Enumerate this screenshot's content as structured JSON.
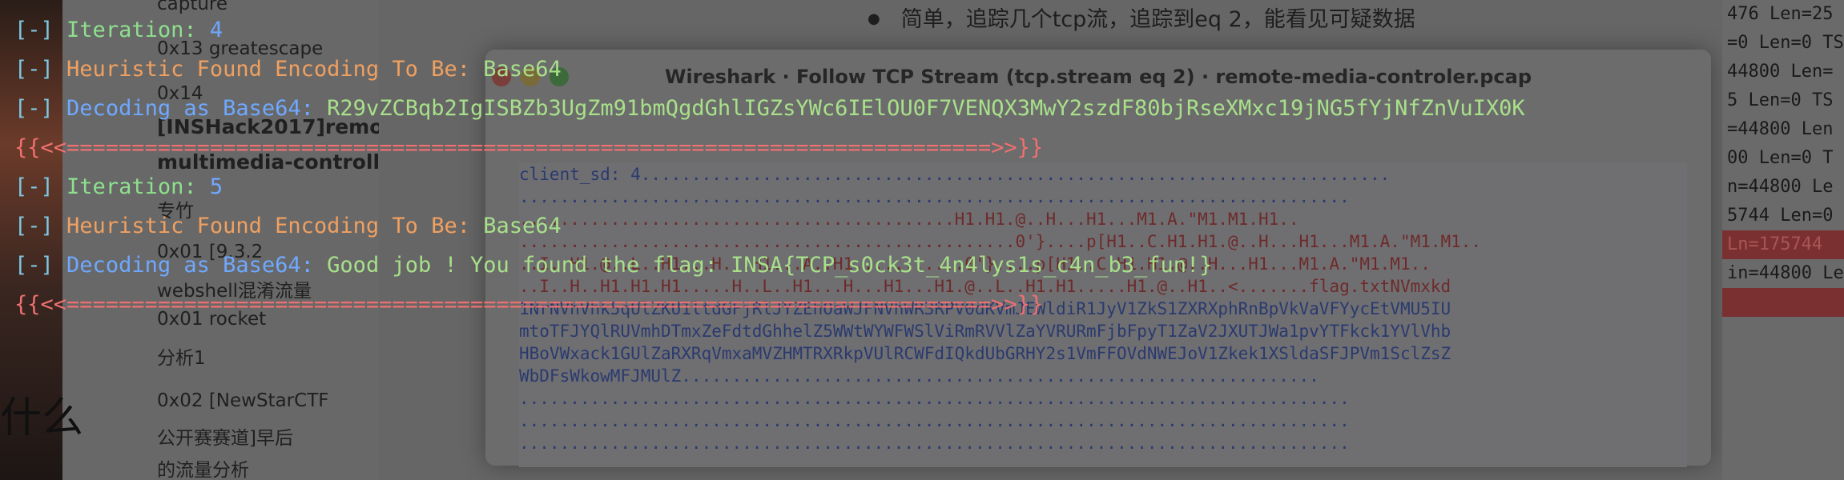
{
  "underlay": {
    "blog_sidebar": {
      "items": [
        "capture",
        "0x13 greatescape",
        "0x14",
        "[INSHack2017]remo",
        "multimedia-controller",
        "专竹",
        "0x01 [9.3.2",
        "webshell混淆流量",
        "0x01 rocket",
        "分析1",
        "0x02 [NewStarCTF",
        "公开赛赛道]早后",
        "的流量分析"
      ],
      "big_char": "什么"
    },
    "article_bullet": "简单，追踪几个tcp流，追踪到eq 2，能看见可疑数据",
    "wireshark": {
      "title": "Wireshark · Follow TCP Stream (tcp.stream eq 2) · remote-media-controler.pcap",
      "stream_lines": [
        {
          "text": "client_sd: 4..........................................................................",
          "tone": "blue"
        },
        {
          "text": "..................................................................................",
          "tone": "blue"
        },
        {
          "text": "...........................................H1.H1.@..H...H1...M1.A.\"M1.M1.H1..",
          "tone": "red"
        },
        {
          "text": ".................................................0'}....p[H1..C.H1.H1.@..H...H1...M1.A.\"M1.M1..",
          "tone": "red"
        },
        {
          "text": "..I..H1.@..L..H1...H...H1...A..H1...........0'}....p[H1..C.H1.H1.@..H...H1...M1.A.\"M1.M1..",
          "tone": "red"
        },
        {
          "text": "..I..H..H1.H1.H1.....H..L..H1...H...H1...H1.@..L..H1.H1.....H1.@..H1..<.......flag.txtNVmxkd",
          "tone": "red"
        },
        {
          "text": "1NrNVhVhk5qUlZKU1ltdGFjRlJYZEhOaWJFNVhWR3RPV0dKVmJEWldiR1JyV1ZkS1ZXRXphRnBpVkVaVFYycEtVMU5IU",
          "tone": "blue"
        },
        {
          "text": "mtoTFJYQlRUVmhDTmxZeFdtdGhhelZ5WWtWYWFWSlViRmRVVlZaYVRURmFjbFpyT1ZaV2JXUTJWa1pvYTFkck1YVlVhb",
          "tone": "blue"
        },
        {
          "text": "HBoVWxack1GUlZaRXRqVmxaMVZHMTRXRkpVUlRCWFdIQkdUbGRHY2s1VmFFOVdNWEJoV1Zkek1XSldaSFJPVm1SclZsZ",
          "tone": "blue"
        },
        {
          "text": "WbDFsWkowMFJMUlZ...............................................................",
          "tone": "blue"
        },
        {
          "text": "..................................................................................",
          "tone": "blue"
        },
        {
          "text": "..................................................................................",
          "tone": "blue"
        },
        {
          "text": "..................................................................................",
          "tone": "blue"
        }
      ]
    },
    "packet_list": [
      {
        "text": "476 Len=25",
        "highlight": false
      },
      {
        "text": "=0 Len=0 TSv",
        "highlight": false
      },
      {
        "text": "44800 Len=",
        "highlight": false
      },
      {
        "text": "5 Len=0 TS",
        "highlight": false
      },
      {
        "text": "=44800 Len",
        "highlight": false
      },
      {
        "text": "00 Len=0 T",
        "highlight": false
      },
      {
        "text": "n=44800 Le",
        "highlight": false
      },
      {
        "text": "5744 Len=0",
        "highlight": false
      },
      {
        "text": "Ln=175744 ",
        "highlight": true
      },
      {
        "text": "in=44800 Le",
        "highlight": false
      },
      {
        "text": "",
        "highlight": true
      }
    ]
  },
  "terminal": {
    "blocks": [
      {
        "prefix": "[-]",
        "iteration_label": "Iteration:",
        "iteration_num": "4",
        "heuristic_label": "Heuristic Found Encoding To Be:",
        "heuristic_value": "Base64",
        "decoding_label": "Decoding as Base64:",
        "decoding_value": "R29vZCBqb2IgISBZb3UgZm91bmQgdGhlIGZsYWc6IElOU0F7VENQX3MwY2szdF80bjRseXMxc19jNG5fYjNfZnVuIX0K",
        "separator": "{{<<=======================================================================>>}}"
      },
      {
        "prefix": "[-]",
        "iteration_label": "Iteration:",
        "iteration_num": "5",
        "heuristic_label": "Heuristic Found Encoding To Be:",
        "heuristic_value": "Base64",
        "decoding_label": "Decoding as Base64:",
        "decoding_value": "Good job ! You found the flag: INSA{TCP_s0ck3t_4n4lys1s_c4n_b3_fun!}",
        "separator": "{{<<=======================================================================>>}}"
      }
    ]
  }
}
